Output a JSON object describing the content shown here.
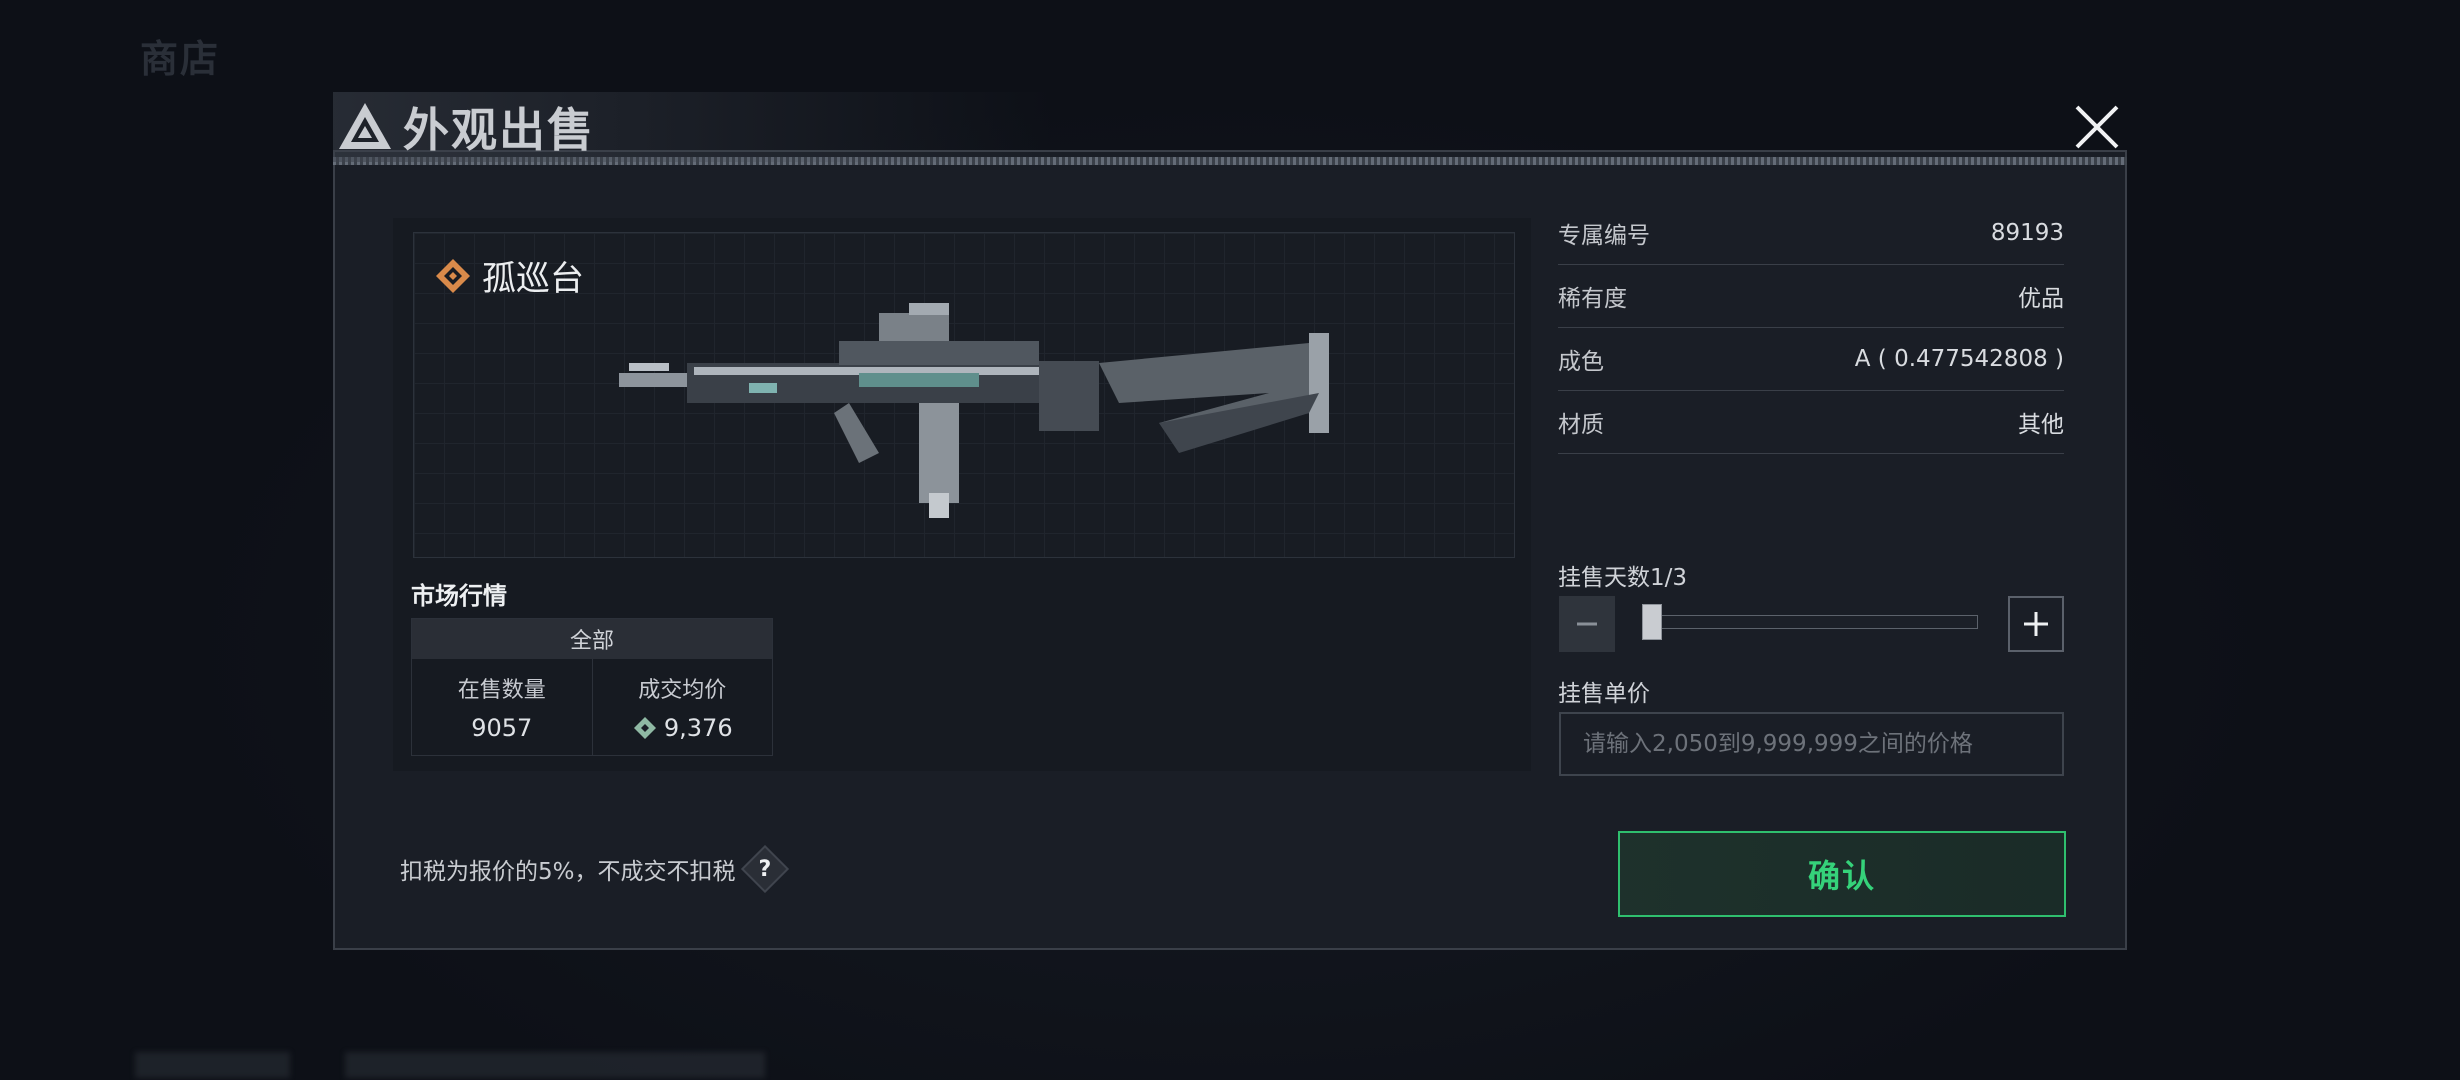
{
  "background": {
    "title": "商店"
  },
  "dialog": {
    "title": "外观出售",
    "close_icon": "close-icon"
  },
  "item": {
    "name": "孤巡台",
    "rarity_icon": "diamond-rarity-icon"
  },
  "market": {
    "title": "市场行情",
    "tab_label": "全部",
    "on_sale_label": "在售数量",
    "on_sale_value": "9057",
    "avg_price_label": "成交均价",
    "avg_price_value": "9,376",
    "currency_icon": "ticket-currency-icon"
  },
  "info": {
    "rows": [
      {
        "key": "专属编号",
        "value": "89193"
      },
      {
        "key": "稀有度",
        "value": "优品"
      },
      {
        "key": "成色",
        "value": "A ( 0.477542808 )"
      },
      {
        "key": "材质",
        "value": "其他"
      }
    ]
  },
  "listing": {
    "days_label": "挂售天数1/3",
    "days_current": 1,
    "days_max": 3,
    "price_label": "挂售单价",
    "price_placeholder": "请输入2,050到9,999,999之间的价格",
    "price_value": ""
  },
  "tax": {
    "text": "扣税为报价的5%，不成交不扣税",
    "help_label": "?"
  },
  "confirm": {
    "label": "确认"
  },
  "colors": {
    "accent_green": "#35d27a",
    "rarity_orange": "#d98a4a",
    "dialog_bg": "#1a1e26"
  }
}
